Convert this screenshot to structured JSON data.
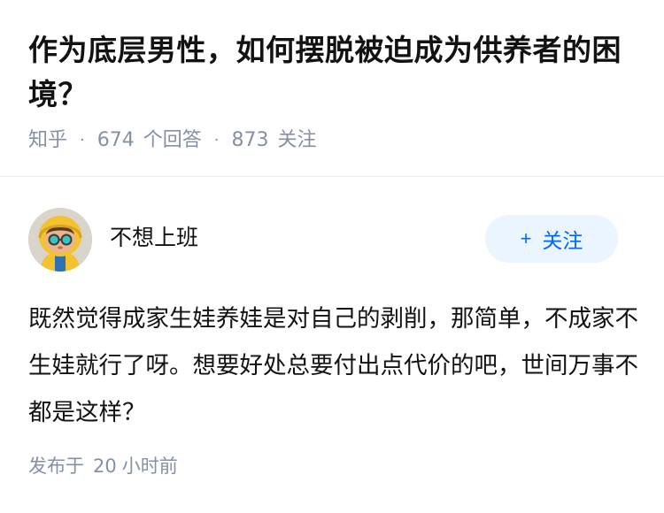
{
  "question": {
    "title": "作为底层男性，如何摆脱被迫成为供养者的困境？",
    "site": "知乎",
    "answer_count": "674",
    "answer_unit": "个回答",
    "follower_count": "873",
    "follower_unit": "关注",
    "separator": "·"
  },
  "answer": {
    "author_name": "不想上班",
    "follow_label": "关注",
    "follow_icon": "plus-icon",
    "content": "既然觉得成家生娃养娃是对自己的剥削，那简单，不成家不生娃就行了呀。想要好处总要付出点代价的吧，世间万事不都是这样？",
    "time_prefix": "发布于",
    "time_value": "20",
    "time_unit": "小时前"
  },
  "colors": {
    "accent": "#0066ff",
    "accent_bg": "#ebf5ff",
    "meta_text": "#8590a6",
    "body_text": "#121212"
  }
}
